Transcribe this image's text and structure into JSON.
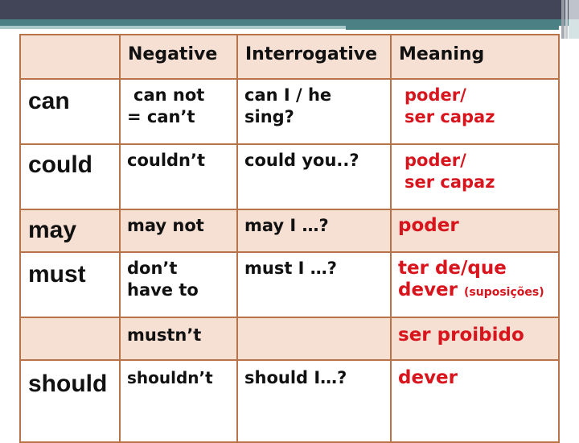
{
  "slide": {
    "colors": {
      "topbar": "#424457",
      "accent_teal": "#4b8185",
      "table_border": "#b87349",
      "row_shade": "#f6dfd3",
      "meaning_text": "#d8141c"
    }
  },
  "table": {
    "headers": [
      "",
      "Negative",
      "Interrogative",
      "Meaning"
    ],
    "rows": [
      {
        "verb": "can",
        "negative": [
          "can not",
          "= can’t"
        ],
        "interrogative": [
          "can I / he",
          "sing?"
        ],
        "meaning": [
          "poder/",
          "ser capaz"
        ]
      },
      {
        "verb": "could",
        "negative": [
          "couldn’t"
        ],
        "interrogative": [
          "could you..?"
        ],
        "meaning": [
          "poder/",
          "ser capaz"
        ]
      },
      {
        "verb": "may",
        "negative": [
          "may not"
        ],
        "interrogative": [
          "may I …?"
        ],
        "meaning": [
          "poder"
        ]
      },
      {
        "verb": "must",
        "negative": [
          "don’t",
          "have to"
        ],
        "interrogative": [
          "must I …?"
        ],
        "meaning": [
          "ter de/que",
          "dever"
        ],
        "meaning_note": "(suposições)"
      },
      {
        "verb": "",
        "negative": [
          "mustn’t"
        ],
        "interrogative": [
          ""
        ],
        "meaning": [
          "ser proibido"
        ]
      },
      {
        "verb": "should",
        "negative": [
          "shouldn’t"
        ],
        "interrogative": [
          "should I…?"
        ],
        "meaning": [
          "dever"
        ]
      }
    ]
  }
}
